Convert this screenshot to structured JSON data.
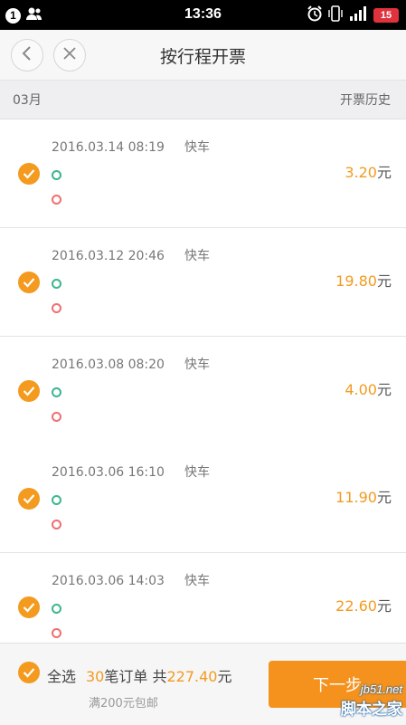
{
  "status_bar": {
    "notification_count": "1",
    "time": "13:36",
    "battery": "15",
    "icons": [
      "notification-badge-icon",
      "contacts-icon",
      "alarm-icon",
      "vibrate-icon",
      "signal-icon",
      "battery-icon"
    ]
  },
  "header": {
    "title": "按行程开票",
    "back_icon": "chevron-left-icon",
    "close_icon": "close-icon"
  },
  "month_bar": {
    "month": "03月",
    "history_link": "开票历史"
  },
  "trips": [
    {
      "datetime": "2016.03.14 08:19",
      "type": "快车",
      "amount": "3.20",
      "unit": "元",
      "selected": true
    },
    {
      "datetime": "2016.03.12 20:46",
      "type": "快车",
      "amount": "19.80",
      "unit": "元",
      "selected": true
    },
    {
      "datetime": "2016.03.08 08:20",
      "type": "快车",
      "amount": "4.00",
      "unit": "元",
      "selected": true
    },
    {
      "datetime": "2016.03.06 16:10",
      "type": "快车",
      "amount": "11.90",
      "unit": "元",
      "selected": true
    },
    {
      "datetime": "2016.03.06 14:03",
      "type": "快车",
      "amount": "22.60",
      "unit": "元",
      "selected": true
    }
  ],
  "bottom_bar": {
    "select_all_label": "全选",
    "order_count": "30",
    "order_label": "笔订单 共",
    "total": "227.40",
    "total_unit": "元",
    "shipping_note": "满200元包邮",
    "next_button_label": "下一步"
  },
  "watermark": {
    "url": "jb51.net",
    "name": "脚本之家"
  },
  "colors": {
    "accent": "#f39a1f",
    "start_dot": "#3bb68f",
    "end_dot": "#ef6f6f",
    "battery": "#e0323c"
  }
}
